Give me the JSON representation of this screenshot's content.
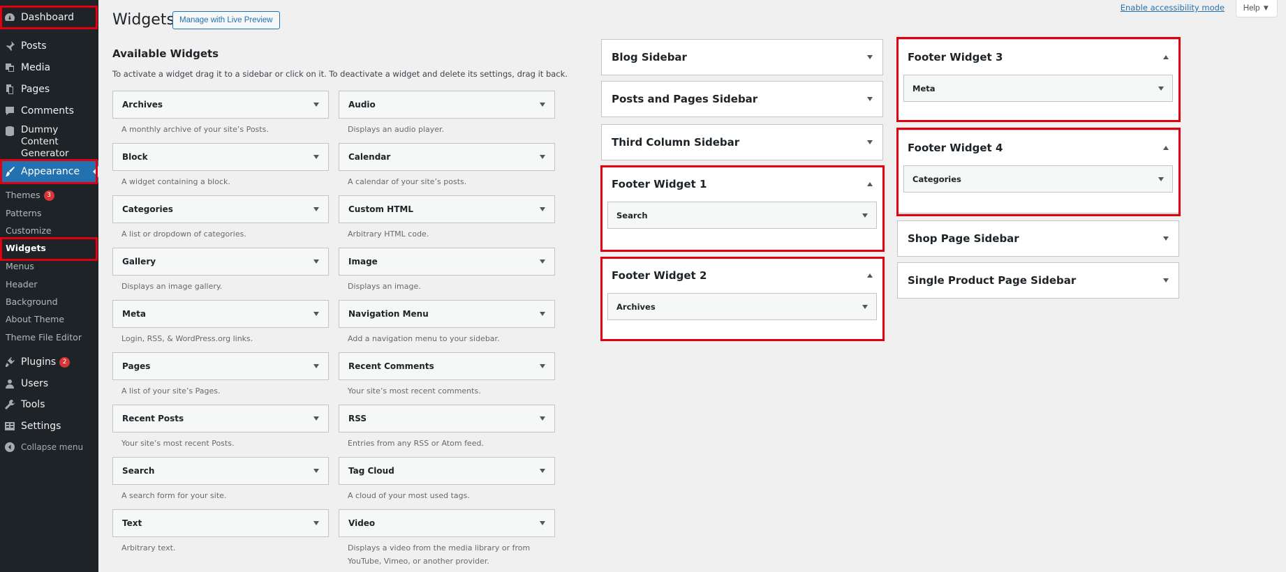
{
  "menu": {
    "dashboard": "Dashboard",
    "posts": "Posts",
    "media": "Media",
    "pages": "Pages",
    "comments": "Comments",
    "dummy_line1": "Dummy Content",
    "dummy_line2": "Generator",
    "appearance": "Appearance",
    "sub": {
      "themes": "Themes",
      "themes_badge": "3",
      "patterns": "Patterns",
      "customize": "Customize",
      "widgets": "Widgets",
      "menus": "Menus",
      "header": "Header",
      "background": "Background",
      "about_theme": "About Theme",
      "theme_file_editor": "Theme File Editor"
    },
    "plugins": "Plugins",
    "plugins_badge": "2",
    "users": "Users",
    "tools": "Tools",
    "settings": "Settings",
    "collapse": "Collapse menu"
  },
  "header": {
    "title": "Widgets",
    "live_preview": "Manage with Live Preview",
    "accessibility": "Enable accessibility mode",
    "help": "Help ▼"
  },
  "available": {
    "title": "Available Widgets",
    "description": "To activate a widget drag it to a sidebar or click on it. To deactivate a widget and delete its settings, drag it back.",
    "widgets": [
      {
        "name": "Archives",
        "desc": "A monthly archive of your site’s Posts."
      },
      {
        "name": "Audio",
        "desc": "Displays an audio player."
      },
      {
        "name": "Block",
        "desc": "A widget containing a block."
      },
      {
        "name": "Calendar",
        "desc": "A calendar of your site’s posts."
      },
      {
        "name": "Categories",
        "desc": "A list or dropdown of categories."
      },
      {
        "name": "Custom HTML",
        "desc": "Arbitrary HTML code."
      },
      {
        "name": "Gallery",
        "desc": "Displays an image gallery."
      },
      {
        "name": "Image",
        "desc": "Displays an image."
      },
      {
        "name": "Meta",
        "desc": "Login, RSS, & WordPress.org links."
      },
      {
        "name": "Navigation Menu",
        "desc": "Add a navigation menu to your sidebar."
      },
      {
        "name": "Pages",
        "desc": "A list of your site’s Pages."
      },
      {
        "name": "Recent Comments",
        "desc": "Your site’s most recent comments."
      },
      {
        "name": "Recent Posts",
        "desc": "Your site’s most recent Posts."
      },
      {
        "name": "RSS",
        "desc": "Entries from any RSS or Atom feed."
      },
      {
        "name": "Search",
        "desc": "A search form for your site."
      },
      {
        "name": "Tag Cloud",
        "desc": "A cloud of your most used tags."
      },
      {
        "name": "Text",
        "desc": "Arbitrary text."
      },
      {
        "name": "Video",
        "desc": "Displays a video from the media library or from YouTube, Vimeo, or another provider."
      }
    ]
  },
  "sidebars": {
    "blog": "Blog Sidebar",
    "posts_pages": "Posts and Pages Sidebar",
    "third_column": "Third Column Sidebar",
    "footer1": {
      "title": "Footer Widget 1",
      "widget": "Search"
    },
    "footer2": {
      "title": "Footer Widget 2",
      "widget": "Archives"
    },
    "footer3": {
      "title": "Footer Widget 3",
      "widget": "Meta"
    },
    "footer4": {
      "title": "Footer Widget 4",
      "widget": "Categories"
    },
    "shop": "Shop Page Sidebar",
    "single_product": "Single Product Page Sidebar"
  },
  "colors": {
    "highlight": "#e0000f",
    "admin_menu": "#1d2327",
    "accent": "#2271b1",
    "badge": "#d63638"
  }
}
